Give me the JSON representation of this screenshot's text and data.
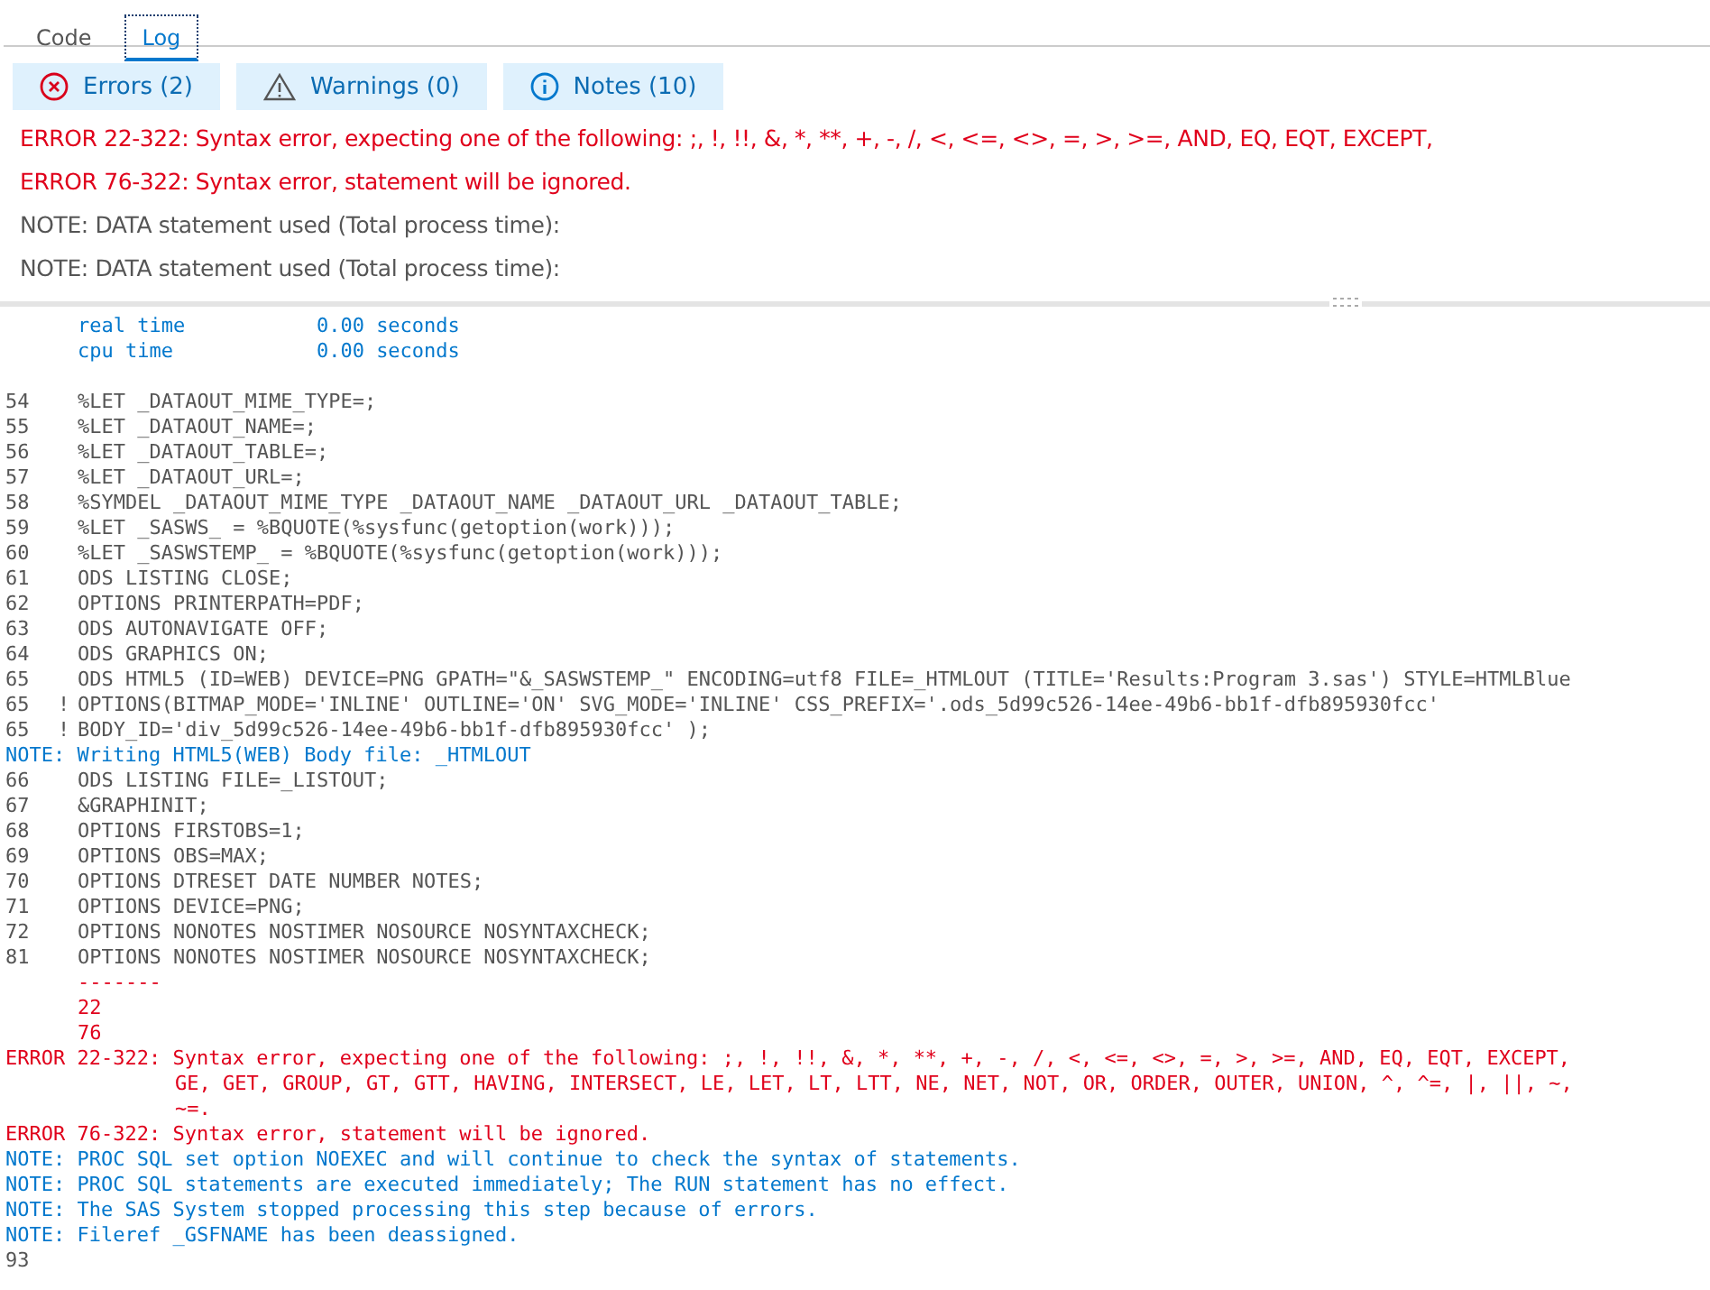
{
  "tabs": [
    {
      "label": "Code",
      "selected": false
    },
    {
      "label": "Log",
      "selected": true
    }
  ],
  "filters": [
    {
      "kind": "error",
      "label": "Errors (2)"
    },
    {
      "kind": "warning",
      "label": "Warnings (0)"
    },
    {
      "kind": "note",
      "label": "Notes (10)"
    }
  ],
  "summary": [
    {
      "kind": "error",
      "text": "ERROR 22-322: Syntax error, expecting one of the following: ;, !, !!, &, *, **, +, -, /, <, <=, <>, =, >, >=, AND, EQ, EQT, EXCEPT,"
    },
    {
      "kind": "error",
      "text": "ERROR 76-322: Syntax error, statement will be ignored."
    },
    {
      "kind": "note",
      "text": "NOTE: DATA statement used (Total process time):"
    },
    {
      "kind": "note",
      "text": "NOTE: DATA statement used (Total process time):"
    }
  ],
  "log": [
    {
      "kind": "stat",
      "text": "real time           0.00 seconds"
    },
    {
      "kind": "stat",
      "text": "cpu time            0.00 seconds"
    },
    {
      "kind": "blank"
    },
    {
      "kind": "source",
      "number": "54",
      "text": "%LET _DATAOUT_MIME_TYPE=;"
    },
    {
      "kind": "source",
      "number": "55",
      "text": "%LET _DATAOUT_NAME=;"
    },
    {
      "kind": "source",
      "number": "56",
      "text": "%LET _DATAOUT_TABLE=;"
    },
    {
      "kind": "source",
      "number": "57",
      "text": "%LET _DATAOUT_URL=;"
    },
    {
      "kind": "source",
      "number": "58",
      "text": "%SYMDEL _DATAOUT_MIME_TYPE _DATAOUT_NAME _DATAOUT_URL _DATAOUT_TABLE;"
    },
    {
      "kind": "source",
      "number": "59",
      "text": "%LET _SASWS_ = %BQUOTE(%sysfunc(getoption(work)));"
    },
    {
      "kind": "source",
      "number": "60",
      "text": "%LET _SASWSTEMP_ = %BQUOTE(%sysfunc(getoption(work)));"
    },
    {
      "kind": "source",
      "number": "61",
      "text": "ODS LISTING CLOSE;"
    },
    {
      "kind": "source",
      "number": "62",
      "text": "OPTIONS PRINTERPATH=PDF;"
    },
    {
      "kind": "source",
      "number": "63",
      "text": "ODS AUTONAVIGATE OFF;"
    },
    {
      "kind": "source",
      "number": "64",
      "text": "ODS GRAPHICS ON;"
    },
    {
      "kind": "source",
      "number": "65",
      "text": "ODS HTML5 (ID=WEB) DEVICE=PNG GPATH=\"&_SASWSTEMP_\" ENCODING=utf8 FILE=_HTMLOUT (TITLE='Results:Program 3.sas') STYLE=HTMLBlue"
    },
    {
      "kind": "source",
      "number": "65",
      "flag": "!",
      "text": "OPTIONS(BITMAP_MODE='INLINE' OUTLINE='ON' SVG_MODE='INLINE' CSS_PREFIX='.ods_5d99c526-14ee-49b6-bb1f-dfb895930fcc'"
    },
    {
      "kind": "source",
      "number": "65",
      "flag": "!",
      "text": "BODY_ID='div_5d99c526-14ee-49b6-bb1f-dfb895930fcc' );"
    },
    {
      "kind": "note",
      "lines": [
        "NOTE: Writing HTML5(WEB) Body file: _HTMLOUT"
      ]
    },
    {
      "kind": "source",
      "number": "66",
      "text": "ODS LISTING FILE=_LISTOUT;"
    },
    {
      "kind": "source",
      "number": "67",
      "text": "&GRAPHINIT;"
    },
    {
      "kind": "source",
      "number": "68",
      "text": "OPTIONS FIRSTOBS=1;"
    },
    {
      "kind": "source",
      "number": "69",
      "text": "OPTIONS OBS=MAX;"
    },
    {
      "kind": "source",
      "number": "70",
      "text": "OPTIONS DTRESET DATE NUMBER NOTES;"
    },
    {
      "kind": "source",
      "number": "71",
      "text": "OPTIONS DEVICE=PNG;"
    },
    {
      "kind": "source",
      "number": "72",
      "text": "OPTIONS NONOTES NOSTIMER NOSOURCE NOSYNTAXCHECK;"
    },
    {
      "kind": "source",
      "number": "81",
      "text": "OPTIONS NONOTES NOSTIMER NOSOURCE NOSYNTAXCHECK;"
    },
    {
      "kind": "marker",
      "text": "-------"
    },
    {
      "kind": "marker",
      "text": "22"
    },
    {
      "kind": "marker",
      "text": "76"
    },
    {
      "kind": "error",
      "lines": [
        "ERROR 22-322: Syntax error, expecting one of the following: ;, !, !!, &, *, **, +, -, /, <, <=, <>, =, >, >=, AND, EQ, EQT, EXCEPT,",
        "GE, GET, GROUP, GT, GTT, HAVING, INTERSECT, LE, LET, LT, LTT, NE, NET, NOT, OR, ORDER, OUTER, UNION, ^, ^=, |, ||, ~,",
        "~=."
      ]
    },
    {
      "kind": "error",
      "lines": [
        "ERROR 76-322: Syntax error, statement will be ignored."
      ]
    },
    {
      "kind": "note",
      "lines": [
        "NOTE: PROC SQL set option NOEXEC and will continue to check the syntax of statements."
      ]
    },
    {
      "kind": "note",
      "lines": [
        "NOTE: PROC SQL statements are executed immediately; The RUN statement has no effect."
      ]
    },
    {
      "kind": "note",
      "lines": [
        "NOTE: The SAS System stopped processing this step because of errors."
      ]
    },
    {
      "kind": "note",
      "lines": [
        "NOTE: Fileref _GSFNAME has been deassigned."
      ]
    },
    {
      "kind": "source",
      "number": "93"
    }
  ]
}
